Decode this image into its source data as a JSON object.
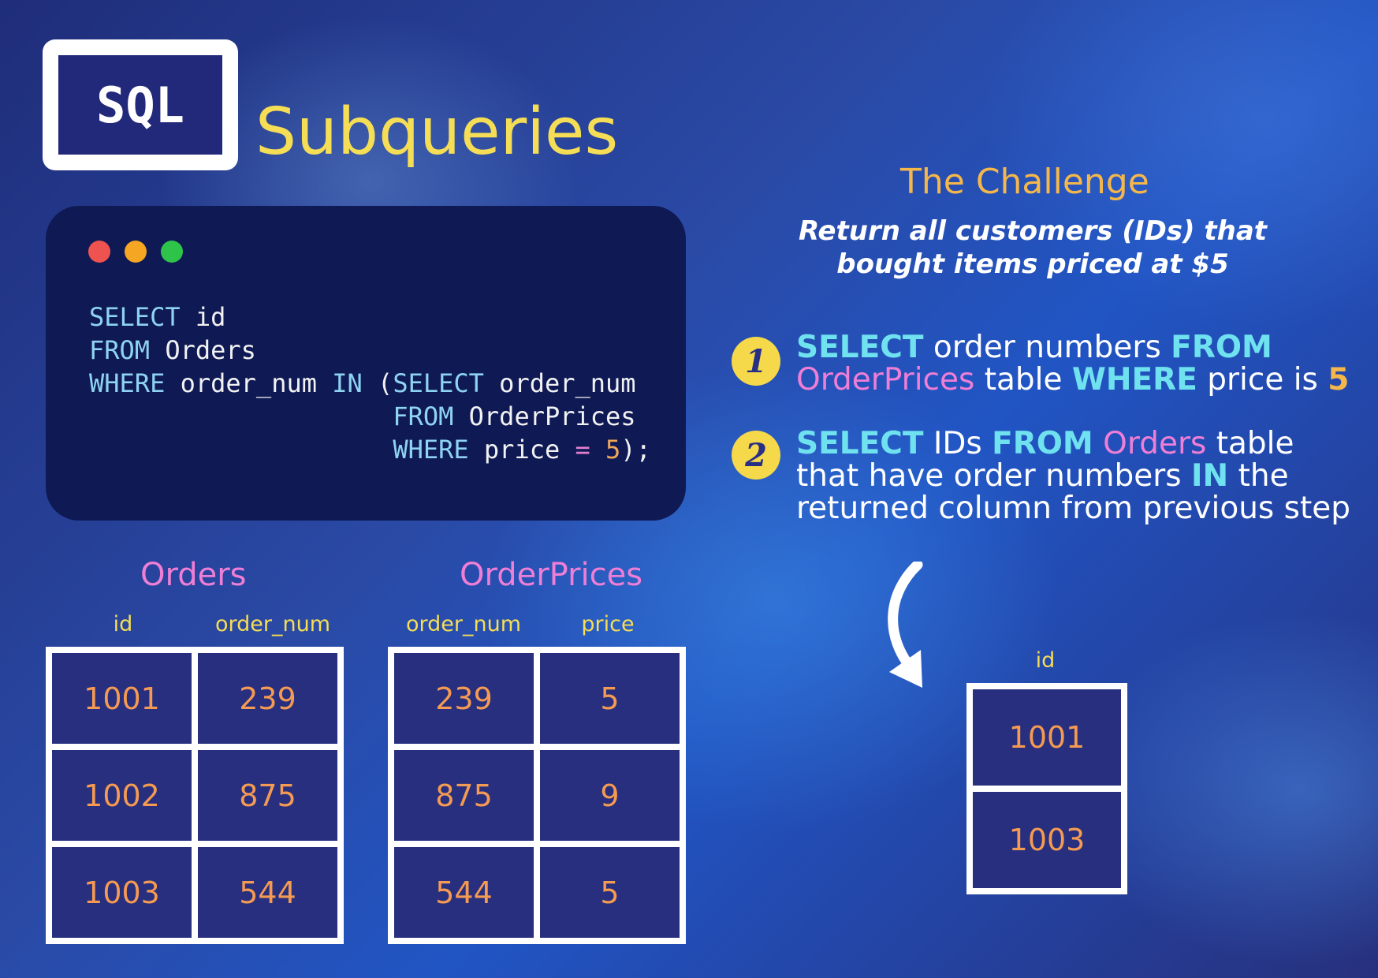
{
  "logo": {
    "text": "SQL"
  },
  "title": "Subqueries",
  "code": {
    "window_dots": [
      "#ef5350",
      "#f5a623",
      "#2ec44a"
    ],
    "lines": [
      [
        {
          "t": "SELECT",
          "k": "kw"
        },
        {
          "t": " id",
          "k": "p"
        }
      ],
      [
        {
          "t": "FROM",
          "k": "kw"
        },
        {
          "t": " Orders",
          "k": "p"
        }
      ],
      [
        {
          "t": "WHERE",
          "k": "kw"
        },
        {
          "t": " order_num ",
          "k": "p"
        },
        {
          "t": "IN",
          "k": "kw"
        },
        {
          "t": " (",
          "k": "p"
        },
        {
          "t": "SELECT",
          "k": "kw"
        },
        {
          "t": " order_num",
          "k": "p"
        }
      ],
      [
        {
          "t": "                    ",
          "k": "p"
        },
        {
          "t": "FROM",
          "k": "kw"
        },
        {
          "t": " OrderPrices",
          "k": "p"
        }
      ],
      [
        {
          "t": "                    ",
          "k": "p"
        },
        {
          "t": "WHERE",
          "k": "kw"
        },
        {
          "t": " price ",
          "k": "p"
        },
        {
          "t": "=",
          "k": "op"
        },
        {
          "t": " ",
          "k": "p"
        },
        {
          "t": "5",
          "k": "num"
        },
        {
          "t": ");",
          "k": "p"
        }
      ]
    ]
  },
  "challenge": {
    "title": "The Challenge",
    "description_line1": "Return all customers (IDs) that",
    "description_line2": "bought items priced at $5"
  },
  "steps": [
    {
      "badge": "1",
      "segments": [
        {
          "t": "SELECT",
          "c": "t-cyan"
        },
        {
          "t": " order numbers ",
          "c": ""
        },
        {
          "t": "FROM",
          "c": "t-cyan"
        },
        {
          "t": "\n",
          "c": ""
        },
        {
          "t": "OrderPrices",
          "c": "t-pink"
        },
        {
          "t": " table ",
          "c": ""
        },
        {
          "t": "WHERE",
          "c": "t-cyan"
        },
        {
          "t": " price is ",
          "c": ""
        },
        {
          "t": "5",
          "c": "t-orange"
        }
      ]
    },
    {
      "badge": "2",
      "segments": [
        {
          "t": "SELECT",
          "c": "t-cyan"
        },
        {
          "t": " IDs ",
          "c": ""
        },
        {
          "t": "FROM",
          "c": "t-cyan"
        },
        {
          "t": " ",
          "c": ""
        },
        {
          "t": "Orders",
          "c": "t-pink"
        },
        {
          "t": " table",
          "c": ""
        },
        {
          "t": "\n",
          "c": ""
        },
        {
          "t": "that have order numbers ",
          "c": ""
        },
        {
          "t": "IN",
          "c": "t-cyan"
        },
        {
          "t": " the",
          "c": ""
        },
        {
          "t": "\n",
          "c": ""
        },
        {
          "t": "returned column from previous step",
          "c": ""
        }
      ]
    }
  ],
  "tables": {
    "orders": {
      "title": "Orders",
      "headers": [
        "id",
        "order_num"
      ],
      "rows": [
        [
          "1001",
          "239"
        ],
        [
          "1002",
          "875"
        ],
        [
          "1003",
          "544"
        ]
      ]
    },
    "order_prices": {
      "title": "OrderPrices",
      "headers": [
        "order_num",
        "price"
      ],
      "rows": [
        [
          "239",
          "5"
        ],
        [
          "875",
          "9"
        ],
        [
          "544",
          "5"
        ]
      ]
    },
    "result": {
      "headers": [
        "id"
      ],
      "rows": [
        [
          "1001"
        ],
        [
          "1003"
        ]
      ]
    }
  },
  "icons": {
    "arrow": "curved-arrow-down-icon"
  }
}
